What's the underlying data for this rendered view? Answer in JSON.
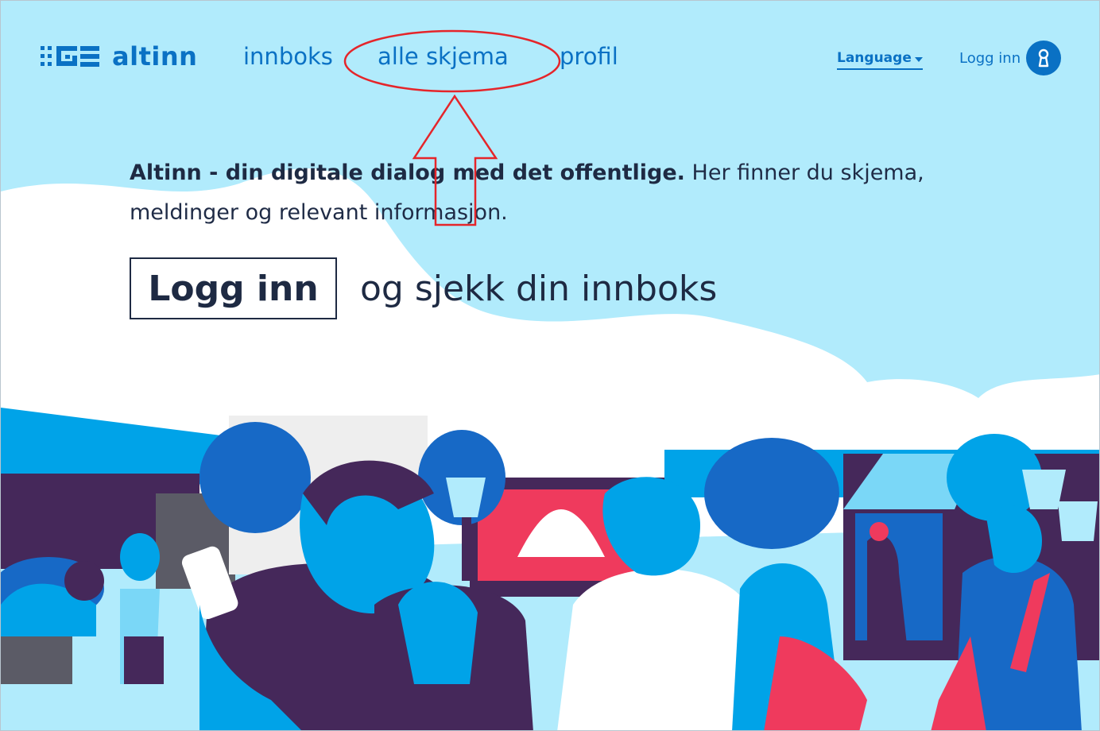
{
  "header": {
    "logo_text": "altinn",
    "logo_icon": "altinn-logo-icon",
    "nav": [
      {
        "label": "innboks"
      },
      {
        "label": "alle skjema"
      },
      {
        "label": "profil"
      }
    ],
    "language_label": "Language",
    "login_label": "Logg inn",
    "login_icon": "keyhole-icon"
  },
  "hero": {
    "intro_bold": "Altinn - din digitale dialog med det offentlige.",
    "intro_rest": " Her finner du skjema, meldinger og relevant informasjon.",
    "cta_button": "Logg inn",
    "cta_suffix": "og sjekk din innboks"
  },
  "colors": {
    "sky": "#b1ebfc",
    "brand_blue": "#0a71c4",
    "dark_navy": "#1e2a43",
    "illustration_purple": "#45285a",
    "illustration_red": "#ef3a5d",
    "annotation_red": "#e5252a"
  }
}
